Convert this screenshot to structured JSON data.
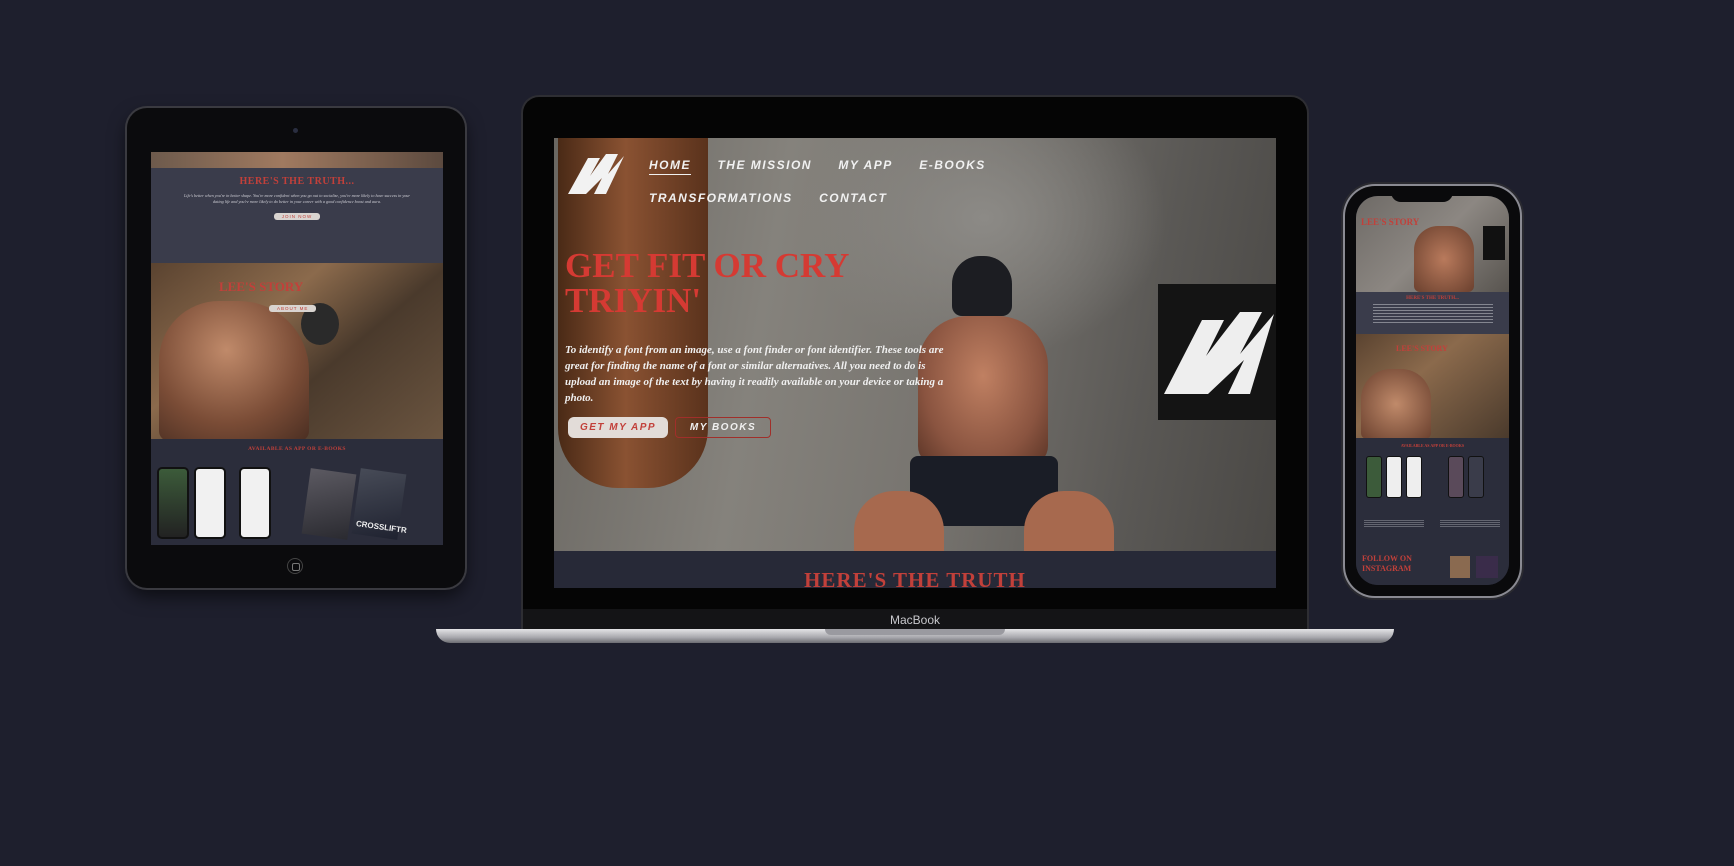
{
  "tablet": {
    "truth_title": "HERE'S THE TRUTH...",
    "truth_button": "JOIN NOW",
    "story_title": "LEE'S STORY",
    "story_button": "ABOUT ME",
    "apps_title": "AVAILABLE AS APP OR E-BOOKS",
    "book_label": "CROSSLIFTR"
  },
  "laptop": {
    "brand": "MacBook",
    "nav": {
      "items": [
        "HOME",
        "THE MISSION",
        "MY APP",
        "E-BOOKS",
        "TRANSFORMATIONS",
        "CONTACT"
      ],
      "active": "HOME"
    },
    "hero": {
      "title": "GET FIT OR CRY TRIYIN'",
      "text": "To identify a font from an image, use a font finder or font identifier. These tools are great for finding the name of a font or similar alternatives. All you need to do is upload an image of the text by having it readily available on your device or taking a photo.",
      "primary_button": "GET MY APP",
      "secondary_button": "MY BOOKS"
    },
    "next_section_title": "HERE'S THE TRUTH"
  },
  "phone": {
    "hero_title": "LEE'S STORY",
    "truth_title": "HERE'S THE TRUTH...",
    "story_title": "LEE'S STORY",
    "apps_title": "AVAILABLE AS APP OR E-BOOKS",
    "follow_title": "FOLLOW ON INSTAGRAM"
  },
  "colors": {
    "background": "#1e1f2d",
    "accent": "#d53a33",
    "button_light": "#e2dcd8"
  },
  "icons": {
    "logo": "lightning-n-logo-icon"
  }
}
